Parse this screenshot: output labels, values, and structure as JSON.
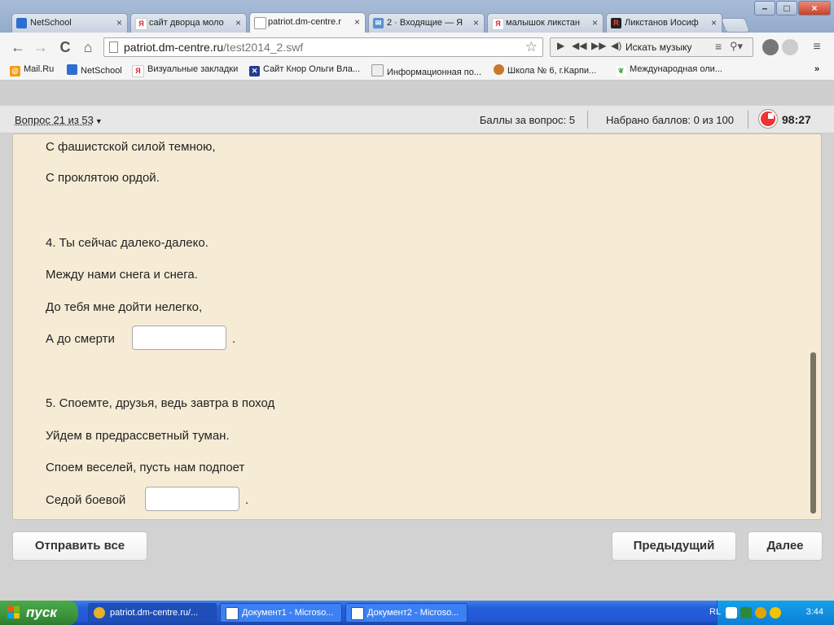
{
  "browser": {
    "tabs": [
      {
        "title": "NetSchool",
        "active": false
      },
      {
        "title": "сайт дворца моло",
        "active": false
      },
      {
        "title": "patriot.dm-centre.r",
        "active": true
      },
      {
        "title": "2 · Входящие — Я",
        "active": false
      },
      {
        "title": "малышок ликстан",
        "active": false
      },
      {
        "title": "Ликстанов Иосиф",
        "active": false
      }
    ],
    "url_host": "patriot.dm-centre.ru",
    "url_path": "/test2014_2.swf",
    "music_search_label": "Искать музыку",
    "bookmarks": [
      "Mail.Ru",
      "NetSchool",
      "Визуальные закладки",
      "Сайт Кнор Ольги Вла...",
      "Информационная по...",
      "Школа № 6, г.Карпи...",
      "Международная оли..."
    ],
    "overflow_label": "»",
    "window_controls": [
      "–",
      "□",
      "×"
    ],
    "nav_glyphs": {
      "back": "←",
      "forward": "→",
      "reload": "C",
      "home": "⌂",
      "star": "☆"
    }
  },
  "quiz": {
    "question_selector": "Вопрос 21 из 53",
    "caret": "▼",
    "points_per_question": "Баллы за вопрос: 5",
    "points_total": "Набрано баллов: 0 из 100",
    "timer": "98:27",
    "lines": [
      "С фашистской силой темною,",
      "С проклятою ордой.",
      "4. Ты сейчас далеко-далеко.",
      "Между нами снега и снега.",
      "До тебя мне дойти нелегко,",
      "А до смерти",
      "5. Споемте, друзья, ведь завтра в поход",
      "Уйдем в предрассветный туман.",
      "Споем веселей, пусть нам подпоет",
      "Седой боевой"
    ],
    "period": ".",
    "answer_1": "",
    "answer_2": "",
    "buttons": {
      "submit_all": "Отправить все",
      "previous": "Предыдущий",
      "next": "Далее"
    }
  },
  "taskbar": {
    "start_label": "пуск",
    "tasks": [
      "patriot.dm-centre.ru/...",
      "Документ1 - Microso...",
      "Документ2 - Microso..."
    ],
    "lang": "RL",
    "clock": "3:44"
  }
}
